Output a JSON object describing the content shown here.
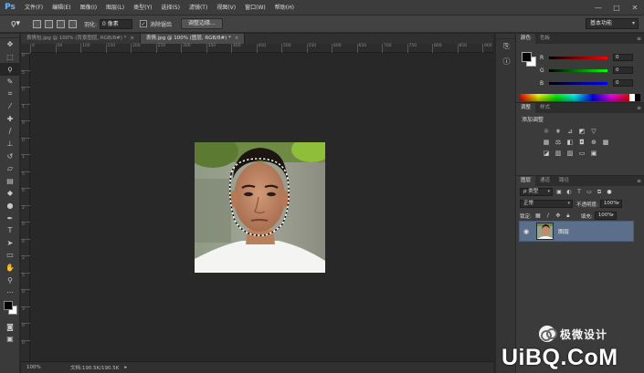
{
  "app": {
    "logo": "Ps"
  },
  "menu": [
    "文件(F)",
    "编辑(E)",
    "图像(I)",
    "图层(L)",
    "类型(Y)",
    "选择(S)",
    "滤镜(T)",
    "视图(V)",
    "窗口(W)",
    "帮助(H)"
  ],
  "window_controls": [
    "—",
    "□",
    "✕"
  ],
  "options": {
    "feather_label": "羽化:",
    "feather_value": "0 像素",
    "antialias_label": "消除锯齿",
    "antialias_checked": "✓",
    "refine_edge": "调整边缘...",
    "workspace": "基本功能"
  },
  "tabs": [
    {
      "label": "表情包.jpg @ 100% (背景图层, RGB/8#) *",
      "close": "×"
    },
    {
      "label": "表情.jpg @ 100% (图层, RGB/8#) *",
      "close": "×"
    }
  ],
  "ruler_h": [
    "0",
    "50",
    "100",
    "150",
    "200",
    "250",
    "300",
    "350",
    "400",
    "450",
    "500",
    "550",
    "600",
    "650",
    "700",
    "750",
    "800",
    "850",
    "900"
  ],
  "ruler_v": [
    "0",
    "5",
    "0",
    "1",
    "0",
    "0",
    "1",
    "5",
    "0",
    "2",
    "0",
    "0",
    "2",
    "5",
    "0",
    "3",
    "0",
    "0"
  ],
  "status": {
    "zoom": "100%",
    "doc": "文档:190.5K/190.5K",
    "arrow": "▸"
  },
  "color_panel": {
    "tabs": [
      "颜色",
      "色板"
    ],
    "channels": [
      {
        "name": "R",
        "value": "0"
      },
      {
        "name": "G",
        "value": "0"
      },
      {
        "name": "B",
        "value": "0"
      }
    ]
  },
  "adjust_panel": {
    "tabs": [
      "调整",
      "样式"
    ],
    "title": "添加调整"
  },
  "layers_panel": {
    "tabs": [
      "图层",
      "通道",
      "路径"
    ],
    "kind": "ρ 类型",
    "blend": "正常",
    "opacity_label": "不透明度:",
    "opacity": "100%",
    "lock_label": "锁定:",
    "fill_label": "填充:",
    "fill": "100%",
    "layer_name": "图层"
  },
  "watermark": {
    "cn": "极微设计",
    "site": "UiBQ.CoM"
  },
  "colors": {
    "selection": "#5c6f8a",
    "panel": "#3b3b3b",
    "canvas": "#282828"
  }
}
